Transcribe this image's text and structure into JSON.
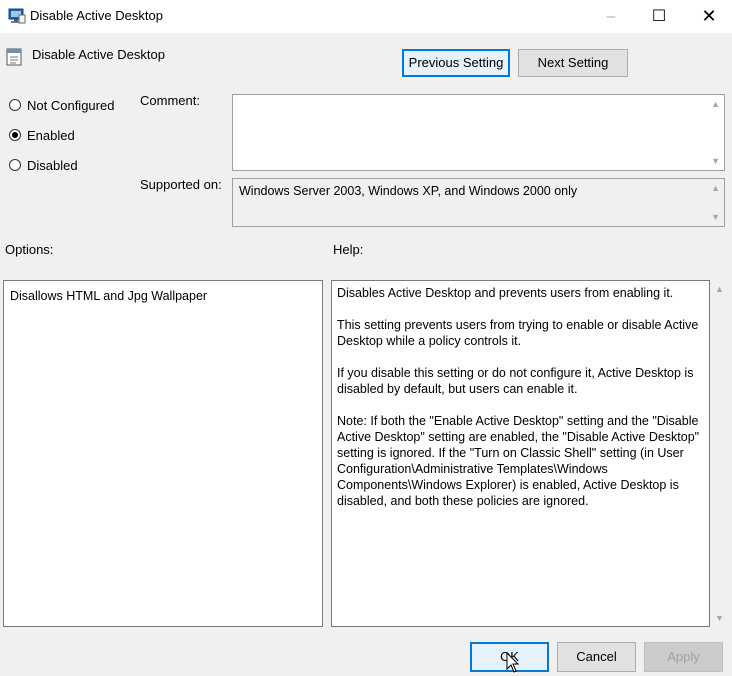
{
  "window": {
    "title": "Disable Active Desktop",
    "minimize_glyph": "–",
    "maximize_glyph": "☐",
    "close_glyph": "✕"
  },
  "header": {
    "policy_name": "Disable Active Desktop",
    "previous_label": "Previous Setting",
    "next_label": "Next Setting"
  },
  "state": {
    "options": [
      {
        "label": "Not Configured",
        "checked": false
      },
      {
        "label": "Enabled",
        "checked": true
      },
      {
        "label": "Disabled",
        "checked": false
      }
    ]
  },
  "comment": {
    "label": "Comment:",
    "value": ""
  },
  "supported": {
    "label": "Supported on:",
    "value": "Windows Server 2003, Windows XP, and Windows 2000 only"
  },
  "options_pane": {
    "label": "Options:",
    "text": "Disallows HTML and Jpg Wallpaper"
  },
  "help_pane": {
    "label": "Help:",
    "paragraphs": [
      "Disables Active Desktop and prevents users from enabling it.",
      "This setting prevents users from trying to enable or disable Active Desktop while a policy controls it.",
      "If you disable this setting or do not configure it, Active Desktop is disabled by default, but users can enable it.",
      "Note: If both the \"Enable Active Desktop\" setting and the \"Disable Active Desktop\" setting are enabled, the \"Disable Active Desktop\" setting is ignored. If the \"Turn on Classic Shell\" setting (in User Configuration\\Administrative Templates\\Windows Components\\Windows Explorer) is enabled, Active Desktop is disabled, and both these policies are ignored."
    ]
  },
  "footer": {
    "ok_label": "OK",
    "cancel_label": "Cancel",
    "apply_label": "Apply"
  },
  "colors": {
    "accent": "#0078d7",
    "window_bg": "#f0f0f0"
  },
  "icons": [
    "app-policy-icon",
    "policy-setting-icon",
    "scroll-up-icon",
    "scroll-down-icon",
    "mouse-cursor-icon"
  ]
}
